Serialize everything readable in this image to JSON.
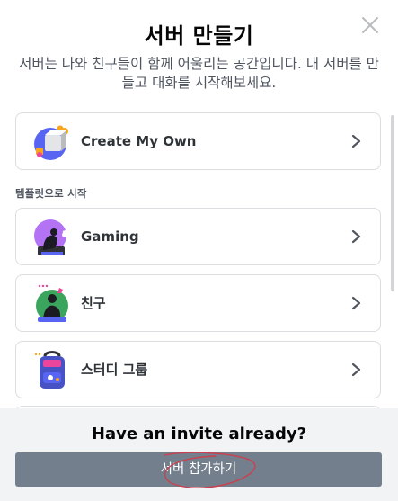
{
  "modal": {
    "title": "서버 만들기",
    "subtitle": "서버는 나와 친구들이 함께 어울리는 공간입니다. 내 서버를 만들고 대화를 시작해보세요.",
    "close_icon": "close-icon"
  },
  "options": {
    "create_own": {
      "label": "Create My Own",
      "icon": "create-server-icon"
    },
    "section_label": "템플릿으로 시작",
    "templates": [
      {
        "label": "Gaming",
        "icon": "gaming-icon"
      },
      {
        "label": "친구",
        "icon": "friends-icon"
      },
      {
        "label": "스터디 그룹",
        "icon": "study-group-icon"
      }
    ]
  },
  "footer": {
    "heading": "Have an invite already?",
    "join_button": "서버 참가하기"
  },
  "colors": {
    "footer_bg": "#f2f3f5",
    "button_bg": "#747f8d",
    "card_border": "#dcdde0",
    "annotation": "#c9404f"
  }
}
